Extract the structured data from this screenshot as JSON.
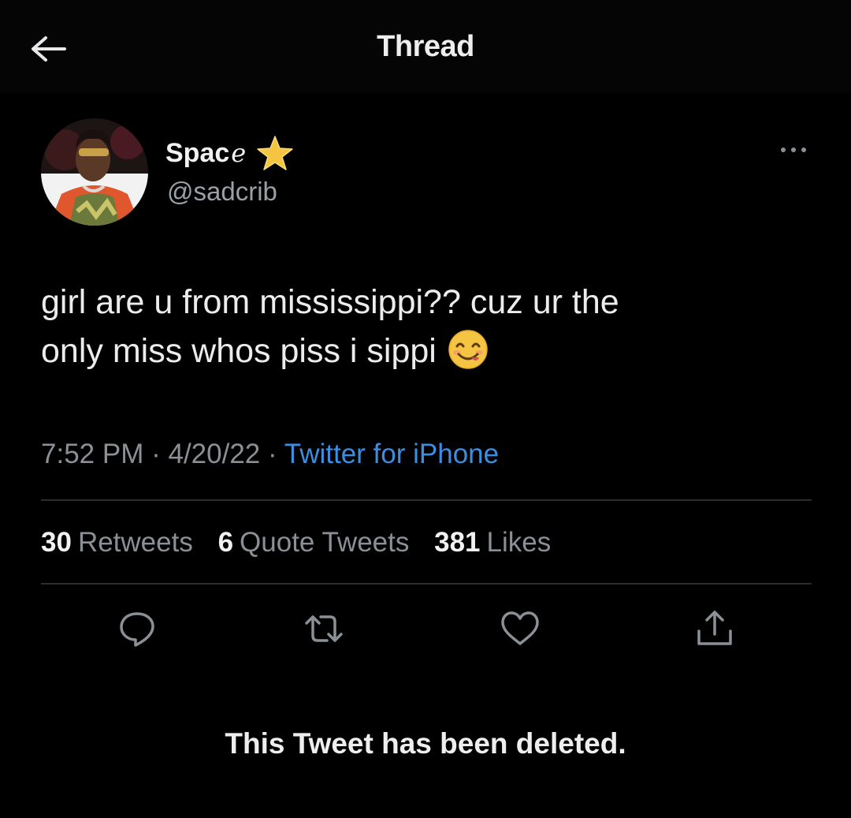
{
  "header": {
    "title": "Thread",
    "back_icon": "arrow-left-icon"
  },
  "tweet": {
    "author": {
      "name_main": "Spac",
      "name_tail": "e",
      "name_emoji": "star-icon",
      "handle": "@sadcrib"
    },
    "text_line1": "girl are u from mississippi?? cuz ur the",
    "text_line2": "only miss whos piss i sippi",
    "text_emoji": "smiling-face-savoring-food-emoji",
    "time": "7:52 PM",
    "date": "4/20/22",
    "separator": "·",
    "source": "Twitter for iPhone",
    "stats": {
      "retweets_count": "30",
      "retweets_label": "Retweets",
      "quotes_count": "6",
      "quotes_label": "Quote Tweets",
      "likes_count": "381",
      "likes_label": "Likes"
    },
    "actions": [
      "reply-icon",
      "retweet-icon",
      "like-icon",
      "share-icon"
    ]
  },
  "deleted_notice": "This Tweet has been deleted.",
  "colors": {
    "background": "#000000",
    "link": "#3b8ee0",
    "secondary_text": "#8b9096",
    "divider": "#2a2d30",
    "star": "#f5c542"
  }
}
